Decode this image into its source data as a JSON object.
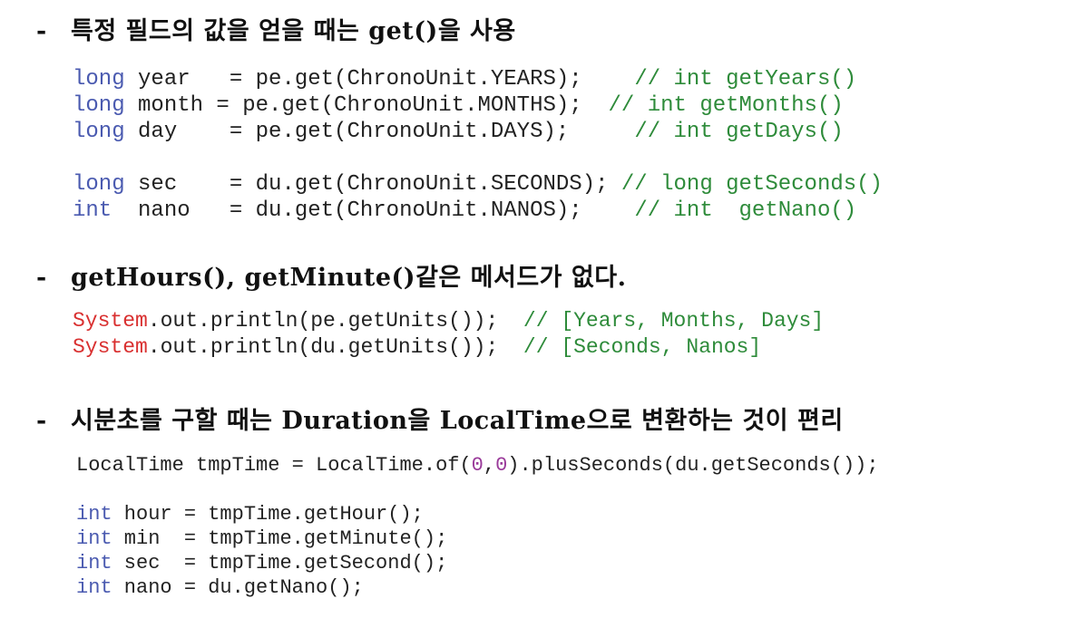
{
  "headings": {
    "h1": {
      "dash": "-",
      "text": "특정 필드의 값을 얻을 때는 get()을 사용"
    },
    "h2": {
      "dash": "-",
      "text": "getHours(), getMinute()같은 메서드가 없다."
    },
    "h3": {
      "dash": "-",
      "text": "시분초를 구할 때는 Duration을 LocalTime으로 변환하는 것이 편리"
    }
  },
  "block1": [
    {
      "kw": "long",
      "rest": " year   = pe.get(ChronoUnit.YEARS);    ",
      "comment": "// int getYears()"
    },
    {
      "kw": "long",
      "rest": " month = pe.get(ChronoUnit.MONTHS);  ",
      "comment": "// int getMonths()"
    },
    {
      "kw": "long",
      "rest": " day    = pe.get(ChronoUnit.DAYS);     ",
      "comment": "// int getDays()"
    },
    {
      "kw": "long",
      "rest": " sec    = du.get(ChronoUnit.SECONDS); ",
      "comment": "// long getSeconds()"
    },
    {
      "kw": "int",
      "rest": "  nano   = du.get(ChronoUnit.NANOS);    ",
      "comment": "// int  getNano()"
    }
  ],
  "block2": [
    {
      "sys": "System",
      "rest": ".out.println(pe.getUnits());  ",
      "comment": "// [Years, Months, Days]"
    },
    {
      "sys": "System",
      "rest": ".out.println(du.getUnits());  ",
      "comment": "// [Seconds, Nanos]"
    }
  ],
  "block3": {
    "first": {
      "a": "LocalTime tmpTime = LocalTime.of(",
      "n1": "0",
      "comma": ",",
      "n2": "0",
      "b": ").plusSeconds(du.getSeconds());"
    },
    "lines": [
      {
        "kw": "int",
        "rest": " hour = tmpTime.getHour();"
      },
      {
        "kw": "int",
        "rest": " min  = tmpTime.getMinute();"
      },
      {
        "kw": "int",
        "rest": " sec  = tmpTime.getSecond();"
      },
      {
        "kw": "int",
        "rest": " nano = du.getNano();"
      }
    ]
  },
  "colors": {
    "keyword": "#4a5ab0",
    "comment": "#2e8b3a",
    "system": "#d93030",
    "number": "#9a3a9a"
  }
}
